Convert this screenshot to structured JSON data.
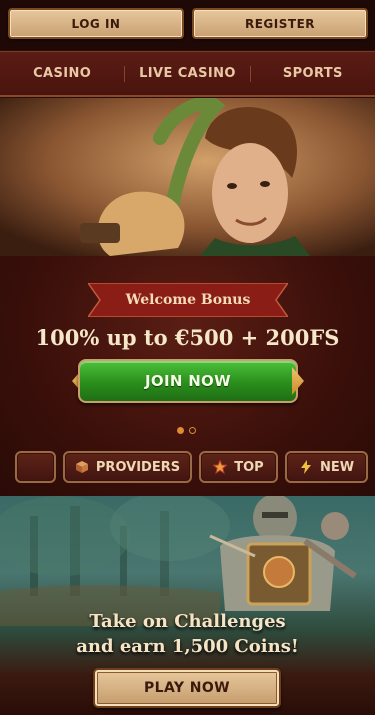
{
  "auth": {
    "login_label": "LOG IN",
    "register_label": "REGISTER"
  },
  "nav": {
    "items": [
      {
        "label": "CASINO"
      },
      {
        "label": "LIVE CASINO"
      },
      {
        "label": "SPORTS"
      }
    ]
  },
  "hero": {
    "image": "archer-character-illustration"
  },
  "promo": {
    "ribbon_label": "Welcome Bonus",
    "headline": "100% up to €500 + 200FS",
    "join_label": "JOIN NOW",
    "slides_total": 2,
    "slide_active": 1
  },
  "categories": {
    "items": [
      {
        "label": "",
        "icon": "blank-icon"
      },
      {
        "label": "PROVIDERS",
        "icon": "providers-icon"
      },
      {
        "label": "TOP",
        "icon": "star-icon"
      },
      {
        "label": "NEW",
        "icon": "lightning-icon"
      }
    ]
  },
  "challenge": {
    "line1": "Take on Challenges",
    "line2": "and earn 1,500 Coins!",
    "play_label": "PLAY NOW",
    "image": "armored-knight-illustration"
  },
  "colors": {
    "primary_green": "#2a8e1c",
    "accent_orange": "#e38b2e",
    "nav_bg": "#4a140e"
  }
}
